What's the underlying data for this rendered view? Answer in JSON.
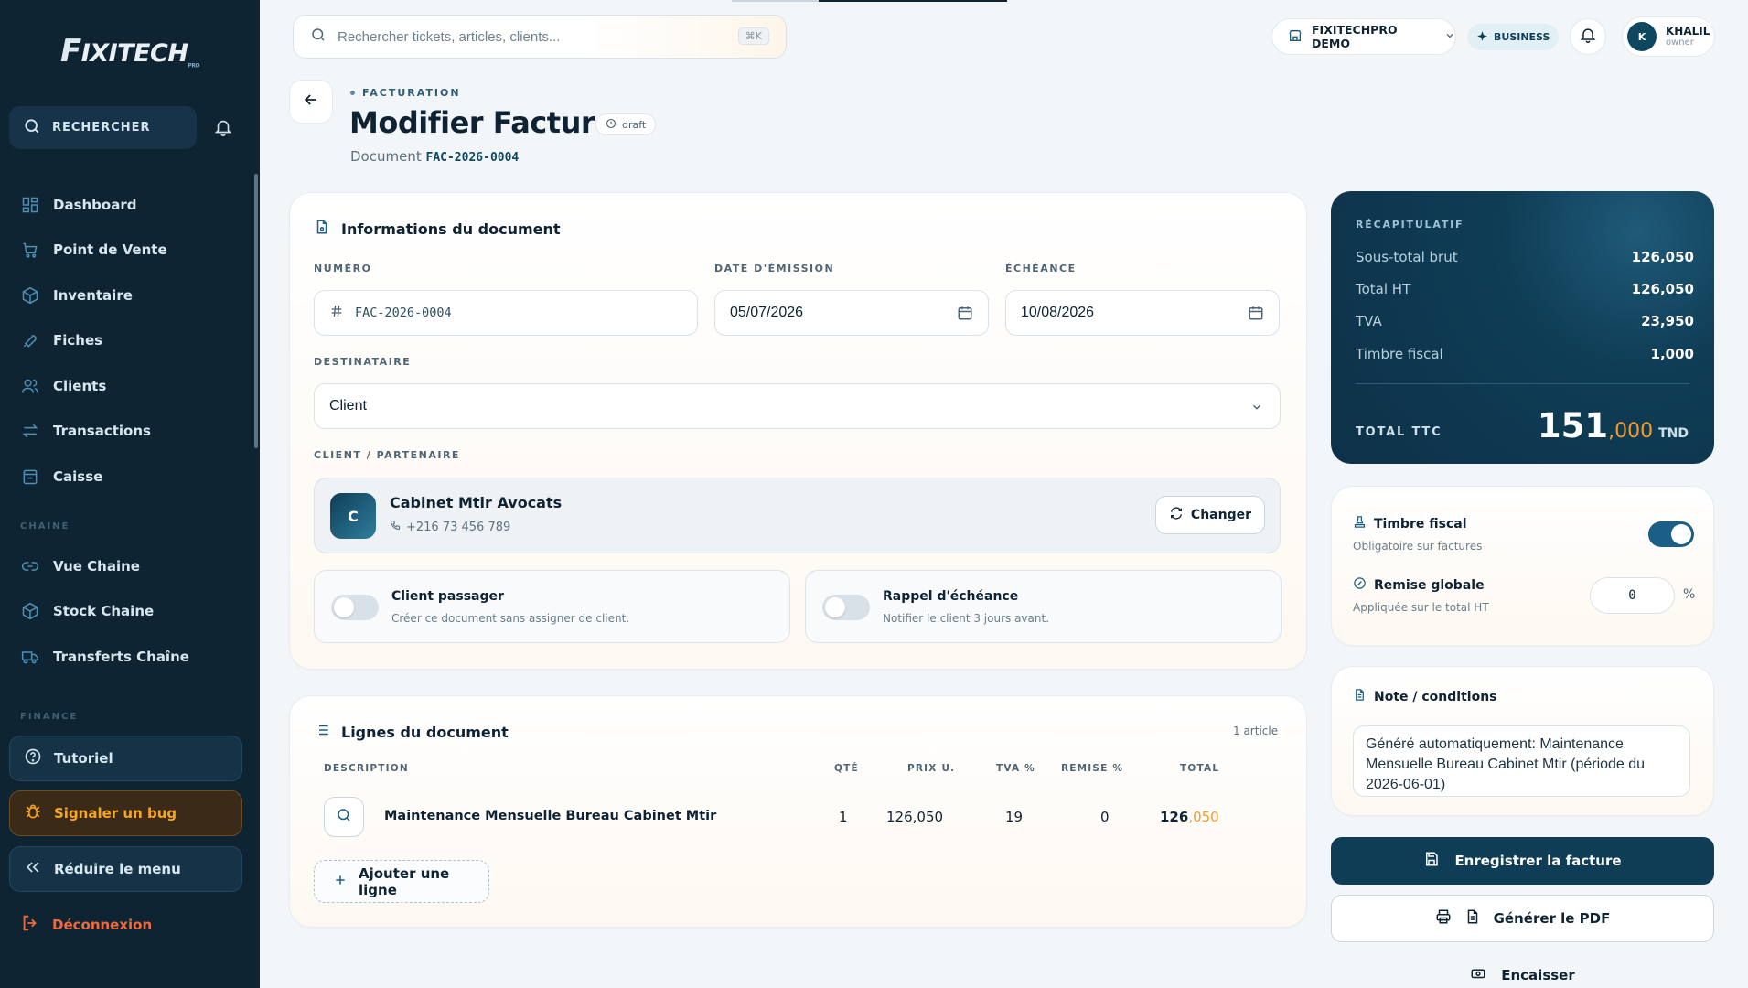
{
  "sidebar": {
    "logo_first": "F",
    "logo_rest": "IXITECH",
    "logo_sub": "PRO",
    "search_label": "RECHERCHER",
    "items": [
      {
        "label": "Dashboard",
        "icon": "dashboard-icon"
      },
      {
        "label": "Point de Vente",
        "icon": "cart-icon"
      },
      {
        "label": "Inventaire",
        "icon": "box-icon"
      },
      {
        "label": "Fiches",
        "icon": "wrench-icon"
      },
      {
        "label": "Clients",
        "icon": "users-icon"
      },
      {
        "label": "Transactions",
        "icon": "transfer-icon"
      },
      {
        "label": "Caisse",
        "icon": "cash-register-icon"
      }
    ],
    "chain_section": "CHAINE",
    "chain_items": [
      {
        "label": "Vue Chaine",
        "icon": "link-icon"
      },
      {
        "label": "Stock Chaine",
        "icon": "box-icon"
      },
      {
        "label": "Transferts Chaîne",
        "icon": "truck-icon"
      }
    ],
    "finance_section": "FINANCE",
    "tutorial": "Tutoriel",
    "report_bug": "Signaler un bug",
    "reduce_menu": "Réduire le menu",
    "logout": "Déconnexion"
  },
  "topbar": {
    "search_placeholder": "Rechercher tickets, articles, clients...",
    "shortcut": "⌘K",
    "org": "FIXITECHPRO DEMO",
    "plan": "BUSINESS",
    "user_initial": "K",
    "user_name": "KHALIL",
    "user_role": "owner"
  },
  "header": {
    "breadcrumb": "FACTURATION",
    "title": "Modifier Facture",
    "status": "draft",
    "document_prefix": "Document",
    "document_number": "FAC-2026-0004"
  },
  "info": {
    "title": "Informations du document",
    "numero_label": "NUMÉRO",
    "numero": "FAC-2026-0004",
    "emission_label": "DATE D'ÉMISSION",
    "emission": "05/07/2026",
    "echeance_label": "ÉCHÉANCE",
    "echeance": "10/08/2026",
    "destinataire_label": "DESTINATAIRE",
    "destinataire": "Client",
    "partner_label": "CLIENT / PARTENAIRE",
    "partner_initial": "C",
    "partner_name": "Cabinet Mtir Avocats",
    "partner_phone": "+216 73 456 789",
    "change_label": "Changer",
    "walkin_title": "Client passager",
    "walkin_sub": "Créer ce document sans assigner de client.",
    "reminder_title": "Rappel d'échéance",
    "reminder_sub": "Notifier le client 3 jours avant."
  },
  "lines": {
    "title": "Lignes du document",
    "count": "1 article",
    "headers": [
      "DESCRIPTION",
      "QTÉ",
      "PRIX U.",
      "TVA %",
      "REMISE %",
      "TOTAL"
    ],
    "rows": [
      {
        "description": "Maintenance Mensuelle Bureau Cabinet Mtir",
        "qty": "1",
        "price": "126,050",
        "tva": "19",
        "remise": "0",
        "total_int": "126",
        "total_dec": ",050"
      }
    ],
    "add_label": "Ajouter une ligne"
  },
  "summary": {
    "label": "RÉCAPITULATIF",
    "rows": [
      {
        "k": "Sous-total brut",
        "v": "126,050"
      },
      {
        "k": "Total HT",
        "v": "126,050"
      },
      {
        "k": "TVA",
        "v": "23,950"
      },
      {
        "k": "Timbre fiscal",
        "v": "1,000"
      }
    ],
    "ttc_label": "TOTAL TTC",
    "ttc_int": "151",
    "ttc_dec": ",000",
    "currency": "TND"
  },
  "options": {
    "stamp_title": "Timbre fiscal",
    "stamp_sub": "Obligatoire sur factures",
    "stamp_enabled": true,
    "discount_title": "Remise globale",
    "discount_sub": "Appliquée sur le total HT",
    "discount_value": "0",
    "discount_unit": "%"
  },
  "note": {
    "title": "Note / conditions",
    "text": "Généré automatiquement: Maintenance Mensuelle Bureau Cabinet Mtir (période du 2026-06-01)"
  },
  "actions": {
    "save": "Enregistrer la facture",
    "pdf": "Générer le PDF",
    "cash": "Encaisser"
  },
  "colors": {
    "sidebar": "#0f2433",
    "primary": "#0f3d56",
    "accent": "#f59a2b",
    "danger": "#ef6a3c"
  }
}
